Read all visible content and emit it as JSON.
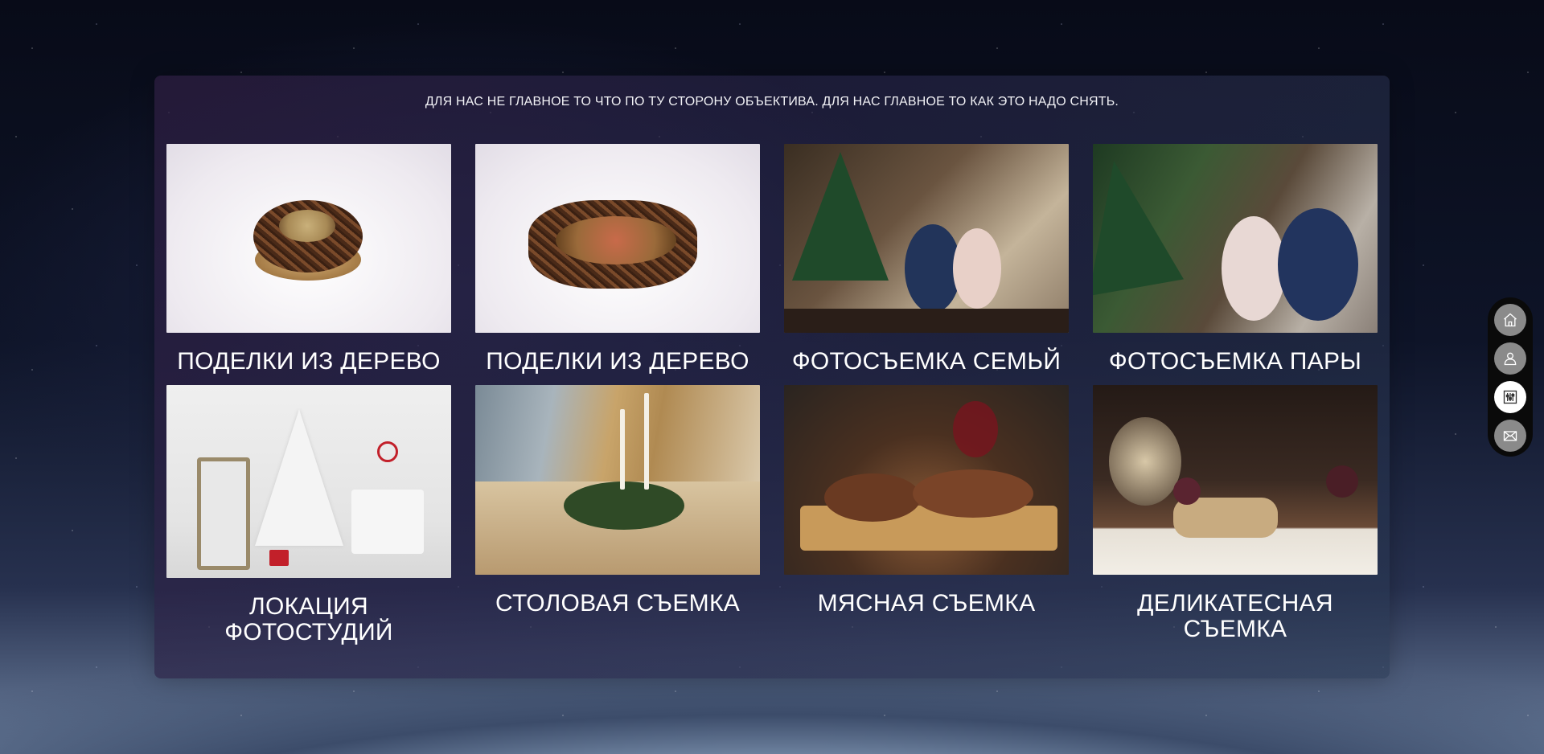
{
  "tagline": "ДЛЯ НАС НЕ ГЛАВНОЕ ТО ЧТО ПО ТУ СТОРОНУ ОБЪЕКТИВА. ДЛЯ НАС ГЛАВНОЕ ТО КАК ЭТО НАДО СНЯТЬ.",
  "gallery": [
    {
      "label": "ПОДЕЛКИ ИЗ ДЕРЕВО"
    },
    {
      "label": "ПОДЕЛКИ ИЗ ДЕРЕВО"
    },
    {
      "label": "ФОТОСЪЕМКА СЕМЬЙ"
    },
    {
      "label": "ФОТОСЪЕМКА ПАРЫ"
    },
    {
      "label_lines": [
        "ЛОКАЦИЯ",
        "ФОТОСТУДИЙ"
      ]
    },
    {
      "label": "СТОЛОВАЯ СЪЕМКА"
    },
    {
      "label": "МЯСНАЯ СЪЕМКА"
    },
    {
      "label_lines": [
        "ДЕЛИКАТЕСНАЯ",
        "СЪЕМКА"
      ]
    }
  ],
  "sidenav": {
    "items": [
      {
        "icon": "home-icon",
        "active": false
      },
      {
        "icon": "user-icon",
        "active": false
      },
      {
        "icon": "sliders-icon",
        "active": true
      },
      {
        "icon": "mail-icon",
        "active": false
      }
    ]
  },
  "colors": {
    "nav_bg": "#0a0a0a",
    "nav_button": "#8a8a8a",
    "nav_button_active": "#ffffff",
    "text": "#ffffff"
  }
}
